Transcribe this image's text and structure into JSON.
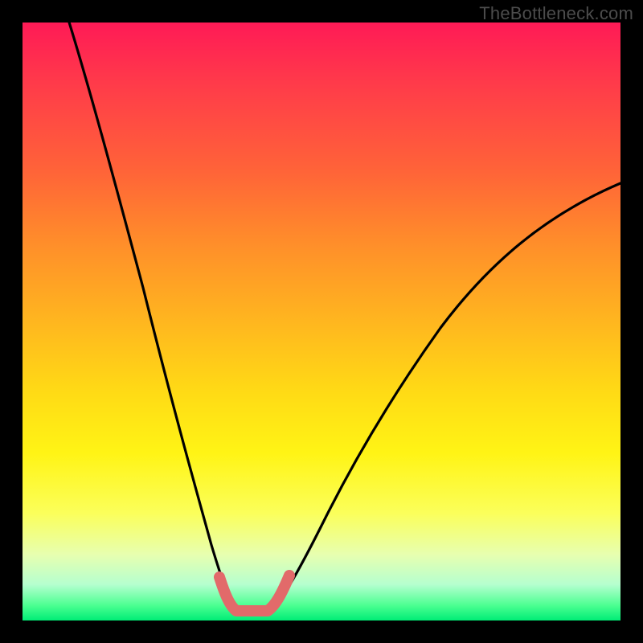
{
  "watermark": "TheBottleneck.com",
  "colors": {
    "frame": "#000000",
    "curve_stroke": "#000000",
    "highlight_stroke": "#e26a6a",
    "grad_top": "#ff1a56",
    "grad_bottom": "#00ed76"
  },
  "chart_data": {
    "type": "line",
    "title": "",
    "xlabel": "",
    "ylabel": "",
    "xlim": [
      0,
      1
    ],
    "ylim": [
      0,
      1
    ],
    "description": "A V-shaped bottleneck curve over a rainbow gradient. High values (red region, near 1.0) at the x-extremes indicate bottleneck; the curve dips to its minimum (green region, near 0.0) around x ≈ 0.37 where components are balanced. A thick salmon overlay highlights the flat minimum between roughly x = 0.33 and x = 0.42.",
    "series": [
      {
        "name": "bottleneck-curve",
        "x": [
          0.0,
          0.05,
          0.1,
          0.15,
          0.2,
          0.25,
          0.3,
          0.33,
          0.36,
          0.38,
          0.4,
          0.42,
          0.45,
          0.5,
          0.55,
          0.6,
          0.65,
          0.7,
          0.75,
          0.8,
          0.85,
          0.9,
          0.95,
          1.0
        ],
        "values": [
          1.0,
          0.92,
          0.81,
          0.69,
          0.56,
          0.4,
          0.2,
          0.07,
          0.02,
          0.02,
          0.02,
          0.06,
          0.13,
          0.24,
          0.33,
          0.41,
          0.48,
          0.54,
          0.59,
          0.63,
          0.67,
          0.7,
          0.72,
          0.73
        ]
      }
    ],
    "highlight_range": {
      "start_x": 0.33,
      "end_x": 0.42
    }
  }
}
